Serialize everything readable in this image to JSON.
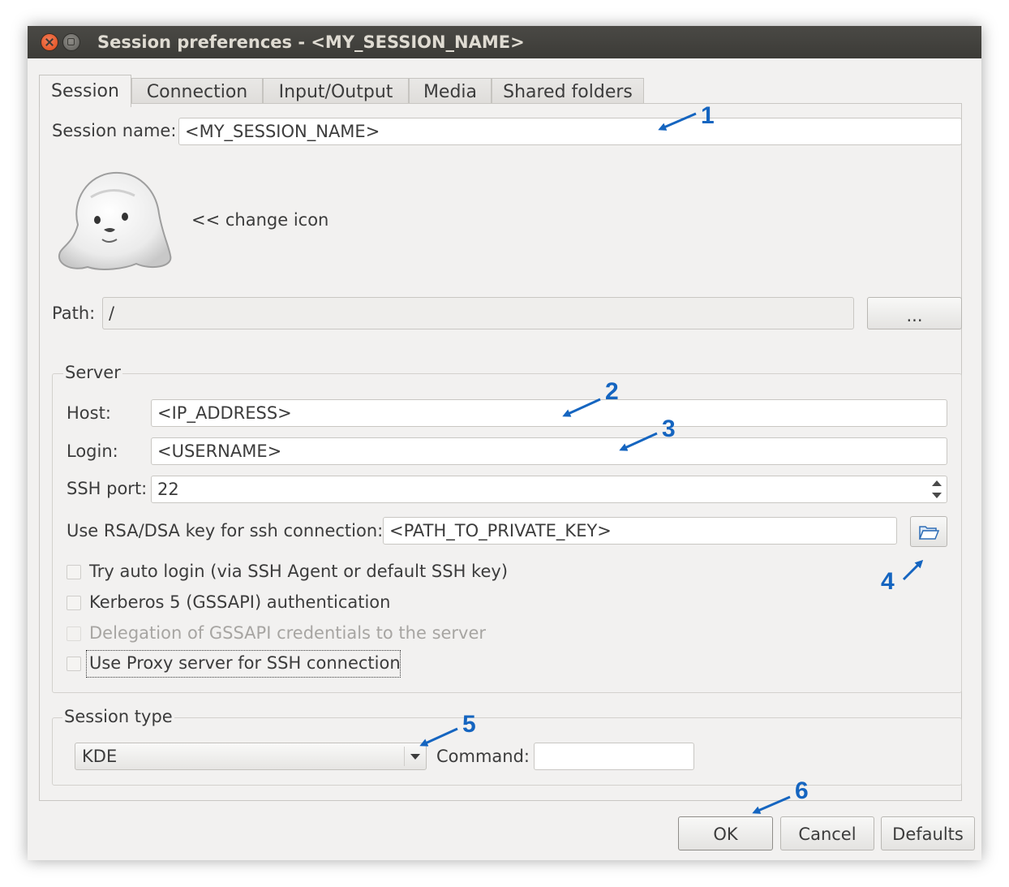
{
  "window": {
    "title": "Session preferences - <MY_SESSION_NAME>"
  },
  "tabs": [
    {
      "label": "Session",
      "active": true
    },
    {
      "label": "Connection"
    },
    {
      "label": "Input/Output"
    },
    {
      "label": "Media"
    },
    {
      "label": "Shared folders"
    }
  ],
  "session": {
    "name_label": "Session name:",
    "name_value": "<MY_SESSION_NAME>",
    "change_icon_label": "<< change icon",
    "path_label": "Path:",
    "path_value": "/",
    "browse_label": "..."
  },
  "server": {
    "title": "Server",
    "host_label": "Host:",
    "host_value": "<IP_ADDRESS>",
    "login_label": "Login:",
    "login_value": "<USERNAME>",
    "port_label": "SSH port:",
    "port_value": "22",
    "key_label": "Use RSA/DSA key for ssh connection:",
    "key_value": "<PATH_TO_PRIVATE_KEY>",
    "checkboxes": [
      {
        "label": "Try auto login (via SSH Agent or default SSH key)",
        "checked": false,
        "enabled": true
      },
      {
        "label": "Kerberos 5 (GSSAPI) authentication",
        "checked": false,
        "enabled": true
      },
      {
        "label": "Delegation of GSSAPI credentials to the server",
        "checked": false,
        "enabled": false
      },
      {
        "label": "Use Proxy server for SSH connection",
        "checked": false,
        "enabled": true
      }
    ]
  },
  "session_type": {
    "title": "Session type",
    "selected": "KDE",
    "command_label": "Command:",
    "command_value": ""
  },
  "buttons": {
    "ok": "OK",
    "cancel": "Cancel",
    "defaults": "Defaults"
  },
  "annotations": [
    "1",
    "2",
    "3",
    "4",
    "5",
    "6"
  ],
  "colors": {
    "annotation": "#1565c0",
    "titlebar": "#3c3b37",
    "background": "#f2f1f0"
  },
  "icons": [
    "close-icon",
    "minimize-icon",
    "folder-open-icon",
    "seal-session-icon",
    "spin-up-icon",
    "spin-down-icon",
    "dropdown-arrow-icon"
  ]
}
